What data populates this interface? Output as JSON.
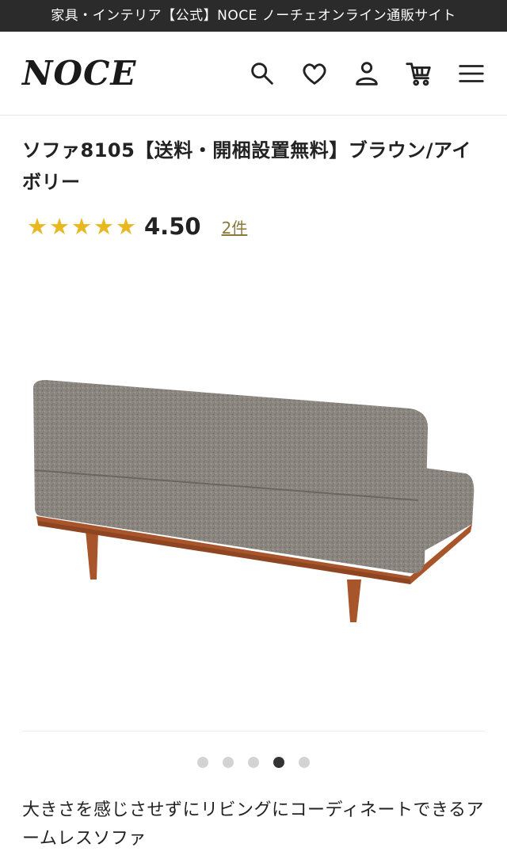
{
  "banner": {
    "text": "家具・インテリア【公式】NOCE ノーチェオンライン通販サイト"
  },
  "header": {
    "logo": "NOCE",
    "icons": [
      "search-icon",
      "heart-icon",
      "user-icon",
      "cart-icon",
      "menu-icon"
    ]
  },
  "product": {
    "title": "ソファ8105【送料・開梱設置無料】ブラウン/アイボリー",
    "rating": {
      "stars": 5,
      "value": "4.50",
      "review_count_label": "2件",
      "star_color": "#e8b820"
    },
    "image": {
      "upholstery_color": "#8b8680",
      "frame_color": "#a9552b"
    },
    "carousel": {
      "total": 5,
      "active_index": 3
    },
    "description": "大きさを感じさせずにリビングにコーディネートできるアームレスソファ"
  }
}
